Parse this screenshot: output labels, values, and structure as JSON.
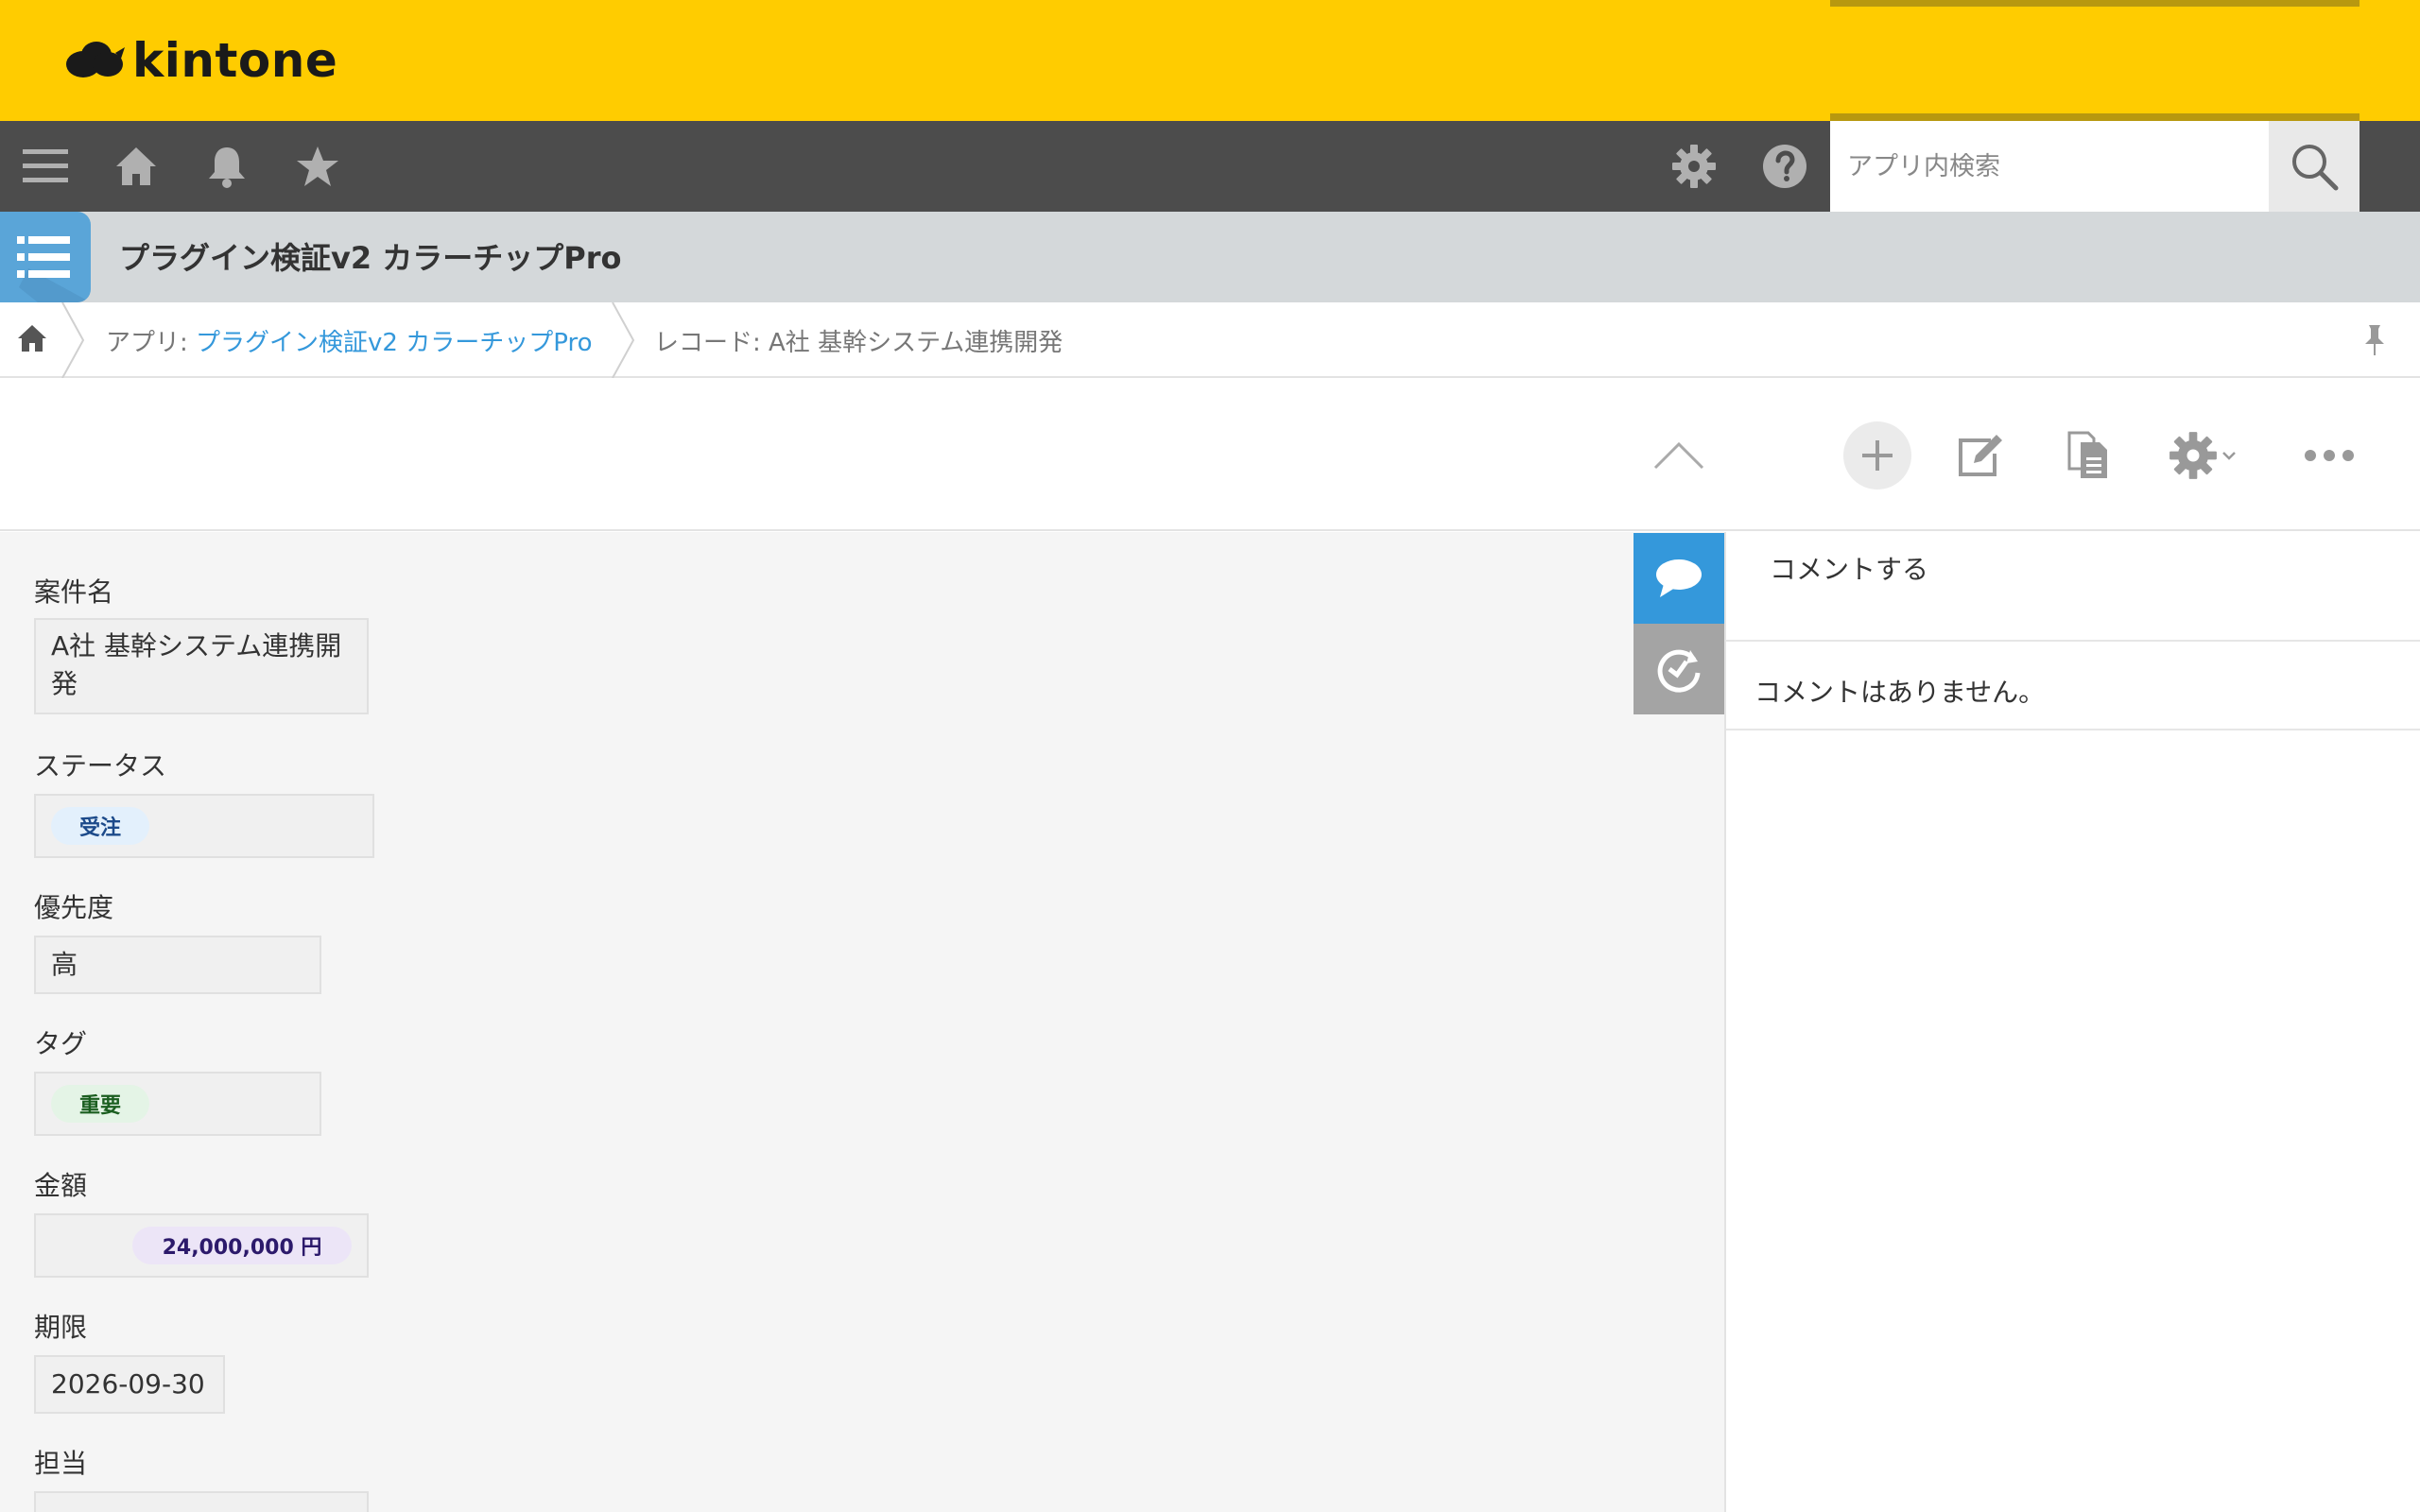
{
  "header": {
    "logo_text": "kintone"
  },
  "nav": {
    "menu_icon": "hamburger-icon",
    "home_icon": "home-icon",
    "notification_icon": "bell-icon",
    "favorites_icon": "star-icon",
    "settings_icon": "gear-icon",
    "help_icon": "help-icon",
    "search_placeholder": "アプリ内検索",
    "search_icon": "search-icon"
  },
  "app": {
    "title": "プラグイン検証v2 カラーチップPro"
  },
  "breadcrumb": {
    "app_prefix": "アプリ: ",
    "app_name": "プラグイン検証v2 カラーチップPro",
    "record_label": "レコード: A社 基幹システム連携開発"
  },
  "toolbar": {
    "collapse_icon": "chevron-up-icon",
    "add_icon": "plus-icon",
    "edit_icon": "edit-icon",
    "copy_icon": "copy-document-icon",
    "settings_icon": "gear-icon",
    "more_icon": "more-icon"
  },
  "fields": {
    "project_name": {
      "label": "案件名",
      "value_line1": "A社 基幹システム連携開",
      "value_line2": "発"
    },
    "status": {
      "label": "ステータス",
      "value": "受注",
      "chip_bg": "#e3f0fc",
      "chip_color": "#1c4a8a"
    },
    "priority": {
      "label": "優先度",
      "value": "高"
    },
    "tag": {
      "label": "タグ",
      "value": "重要",
      "chip_bg": "#e4f4e6",
      "chip_color": "#1b5e20"
    },
    "amount": {
      "label": "金額",
      "value": "24,000,000 円",
      "chip_bg": "#ece5f7",
      "chip_color": "#2c1a6b"
    },
    "due": {
      "label": "期限",
      "value": "2026-09-30"
    },
    "assignee": {
      "label": "担当"
    }
  },
  "side": {
    "comment_tab_icon": "speech-bubble-icon",
    "history_tab_icon": "history-icon",
    "comment_placeholder": "コメントする",
    "no_comments": "コメントはありません。"
  },
  "colors": {
    "header_yellow": "#ffcc00",
    "nav_dark": "#4c4c4c",
    "app_bar": "#d4d8da",
    "accent_blue": "#3498db"
  }
}
